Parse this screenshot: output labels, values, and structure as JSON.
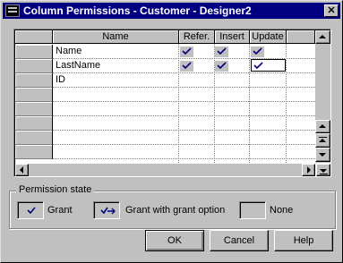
{
  "window": {
    "title": "Column Permissions - Customer - Designer2",
    "close_glyph": "✕"
  },
  "grid": {
    "columns": [
      "Name",
      "Refer.",
      "Insert",
      "Update"
    ],
    "rows": [
      {
        "name": "Name",
        "refer": true,
        "insert": true,
        "update": true
      },
      {
        "name": "LastName",
        "refer": true,
        "insert": true,
        "update": true
      },
      {
        "name": "ID",
        "refer": false,
        "insert": false,
        "update": false
      }
    ]
  },
  "permission_state": {
    "legend": "Permission state",
    "grant": "Grant",
    "grant_with_option": "Grant with grant option",
    "none": "None"
  },
  "buttons": {
    "ok": "OK",
    "cancel": "Cancel",
    "help": "Help"
  },
  "colors": {
    "titlebar": "#000080",
    "check": "#000080",
    "face": "#c0c0c0"
  },
  "icons": [
    "app-icon",
    "close-icon",
    "check-icon",
    "check-arrow-icon",
    "scroll-up-icon",
    "scroll-down-icon",
    "scroll-left-icon",
    "scroll-right-icon",
    "scroll-top-icon",
    "scroll-bottom-icon"
  ]
}
